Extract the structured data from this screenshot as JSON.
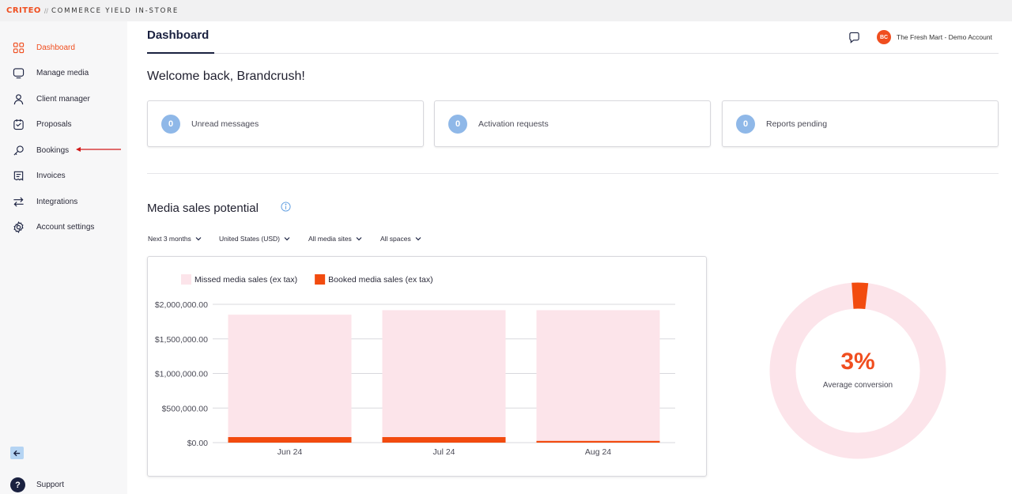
{
  "brand": {
    "logo": "CRITEO",
    "separator": "//",
    "product": "COMMERCE YIELD IN-STORE",
    "accent": "#f04e1f",
    "navy": "#1a2140"
  },
  "sidebar": {
    "items": [
      {
        "label": "Dashboard",
        "icon": "grid-icon",
        "active": true
      },
      {
        "label": "Manage media",
        "icon": "monitor-icon"
      },
      {
        "label": "Client manager",
        "icon": "user-icon"
      },
      {
        "label": "Proposals",
        "icon": "clipboard-icon"
      },
      {
        "label": "Bookings",
        "icon": "key-icon"
      },
      {
        "label": "Invoices",
        "icon": "receipt-icon"
      },
      {
        "label": "Integrations",
        "icon": "swap-arrows-icon"
      },
      {
        "label": "Account settings",
        "icon": "gear-icon"
      }
    ],
    "support_glyph": "?",
    "support_label": "Support"
  },
  "header": {
    "title": "Dashboard",
    "account_initials": "BC",
    "account_name": "The Fresh Mart - Demo Account"
  },
  "welcome": "Welcome back, Brandcrush!",
  "stats": [
    {
      "count": "0",
      "label": "Unread messages"
    },
    {
      "count": "0",
      "label": "Activation requests"
    },
    {
      "count": "0",
      "label": "Reports pending"
    }
  ],
  "media_sales": {
    "title": "Media sales potential",
    "filters": [
      "Next 3 months",
      "United States (USD)",
      "All media sites",
      "All spaces"
    ]
  },
  "chart_data": {
    "type": "bar",
    "stacked": true,
    "categories": [
      "Jun 24",
      "Jul 24",
      "Aug 24"
    ],
    "series": [
      {
        "name": "Booked media sales (ex tax)",
        "color": "#f24b0f",
        "values": [
          80000,
          80000,
          25000
        ]
      },
      {
        "name": "Missed media sales (ex tax)",
        "color": "#fce4ea",
        "values": [
          1770000,
          1835000,
          1890000
        ]
      }
    ],
    "ylim": [
      0,
      2000000
    ],
    "yticks": [
      "$0.00",
      "$500,000.00",
      "$1,000,000.00",
      "$1,500,000.00",
      "$2,000,000.00"
    ],
    "ytick_values": [
      0,
      500000,
      1000000,
      1500000,
      2000000
    ],
    "legend": [
      {
        "name": "Missed media sales (ex tax)",
        "color": "#fce4ea"
      },
      {
        "name": "Booked media sales (ex tax)",
        "color": "#f24b0f"
      }
    ],
    "legend_position": "top-left",
    "grid": true
  },
  "conversion": {
    "value": "3%",
    "fraction": 0.03,
    "label": "Average conversion",
    "track_color": "#fce4ea",
    "fill_color": "#f24b0f"
  }
}
